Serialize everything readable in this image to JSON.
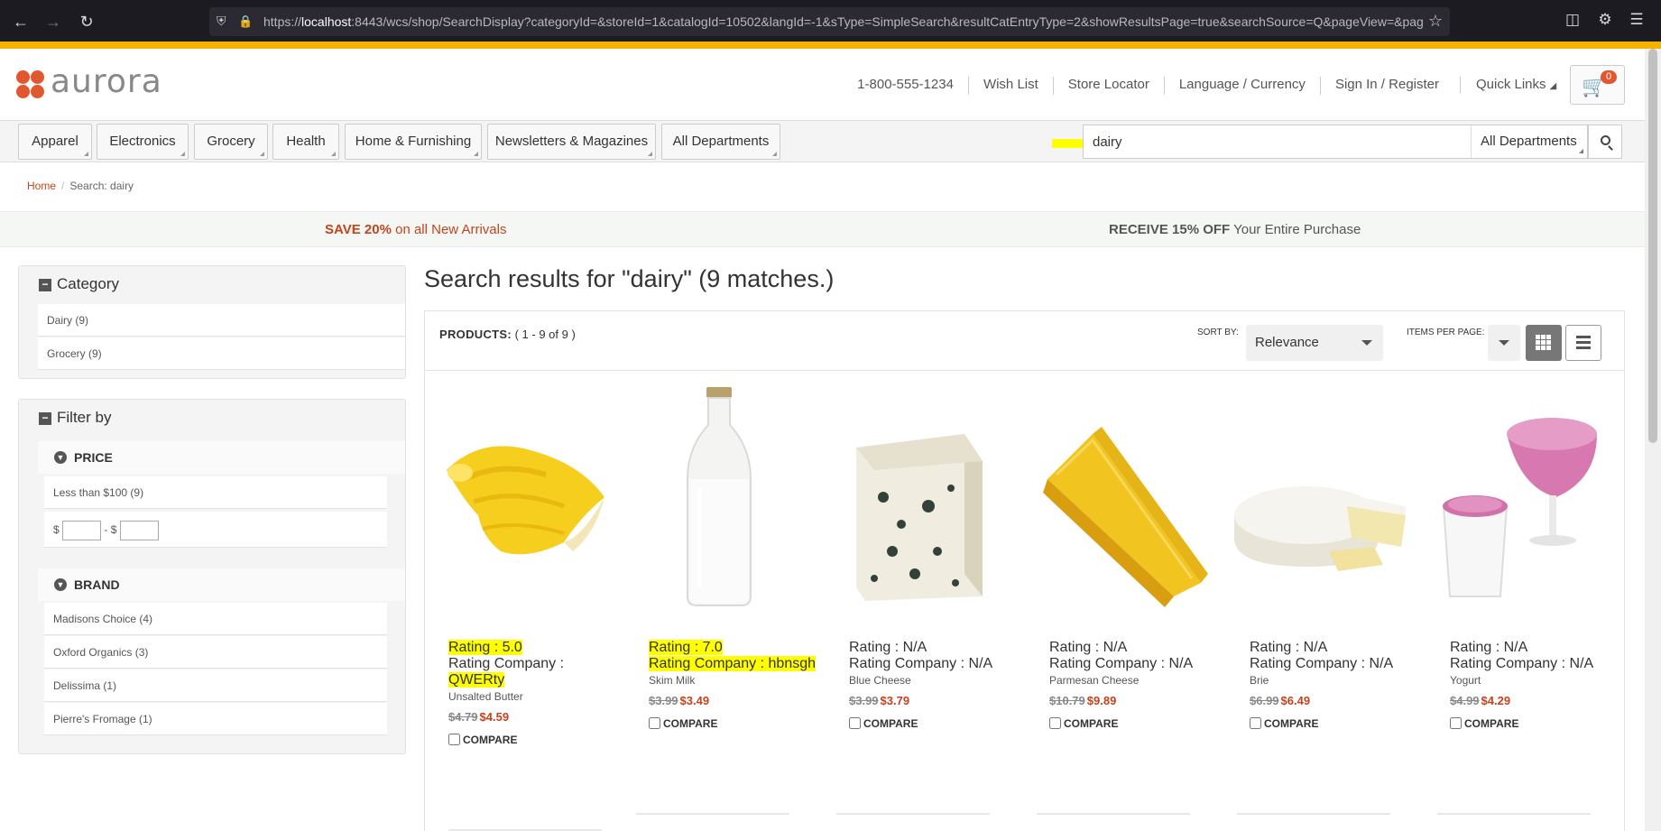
{
  "browser": {
    "url_prefix": "https://",
    "url_host": "localhost",
    "url_rest": ":8443/wcs/shop/SearchDisplay?categoryId=&storeId=1&catalogId=10502&langId=-1&sType=SimpleSearch&resultCatEntryType=2&showResultsPage=true&searchSource=Q&pageView=&pag"
  },
  "header": {
    "logo_text": "aurora",
    "phone": "1-800-555-1234",
    "wish_list": "Wish List",
    "store_locator": "Store Locator",
    "language_currency": "Language / Currency",
    "sign_in": "Sign In / Register",
    "quick_links": "Quick Links",
    "cart_count": "0"
  },
  "nav": {
    "departments": [
      "Apparel",
      "Electronics",
      "Grocery",
      "Health",
      "Home & Furnishing",
      "Newsletters & Magazines",
      "All Departments"
    ],
    "search_value": "dairy",
    "search_dept": "All Departments"
  },
  "breadcrumb": {
    "home": "Home",
    "current": "Search: dairy"
  },
  "promo": {
    "left_bold": "SAVE 20%",
    "left_rest": " on all New Arrivals",
    "right_bold": "RECEIVE 15% OFF",
    "right_rest": " Your Entire Purchase"
  },
  "sidebar": {
    "category_title": "Category",
    "categories": [
      "Dairy (9)",
      "Grocery (9)"
    ],
    "filter_title": "Filter by",
    "price_title": "PRICE",
    "price_options": [
      "Less than $100 (9)"
    ],
    "price_from_label": "$",
    "price_to_label": "- $",
    "brand_title": "BRAND",
    "brands": [
      "Madisons Choice (4)",
      "Oxford Organics (3)",
      "Delissima (1)",
      "Pierre's Fromage (1)"
    ]
  },
  "results": {
    "title": "Search results for \"dairy\" (9 matches.)",
    "products_label": "PRODUCTS:",
    "products_range": "(  1 - 9 of 9  )",
    "sort_label": "SORT BY:",
    "sort_value": "Relevance",
    "ipp_label": "ITEMS PER PAGE:",
    "compare_label": "COMPARE"
  },
  "products": [
    {
      "rating": "Rating : 5.0",
      "company_label": "Rating Company :",
      "company": "QWERty",
      "name": "Unsalted Butter",
      "old_price": "$4.79",
      "new_price": "$4.59"
    },
    {
      "rating": "Rating : 7.0",
      "company_label": "Rating Company :",
      "company": "hbnsgh",
      "name": "Skim Milk",
      "old_price": "$3.99",
      "new_price": "$3.49"
    },
    {
      "rating": "Rating : N/A",
      "company_label": "Rating Company :",
      "company": "N/A",
      "name": "Blue Cheese",
      "old_price": "$3.99",
      "new_price": "$3.79"
    },
    {
      "rating": "Rating : N/A",
      "company_label": "Rating Company :",
      "company": "N/A",
      "name": "Parmesan Cheese",
      "old_price": "$10.79",
      "new_price": "$9.89"
    },
    {
      "rating": "Rating : N/A",
      "company_label": "Rating Company :",
      "company": "N/A",
      "name": "Brie",
      "old_price": "$6.99",
      "new_price": "$6.49"
    },
    {
      "rating": "Rating : N/A",
      "company_label": "Rating Company :",
      "company": "N/A",
      "name": "Yogurt",
      "old_price": "$4.99",
      "new_price": "$4.29"
    }
  ],
  "colors": {
    "accent": "#f3b300",
    "brand": "#e2582e",
    "sale": "#c4431c",
    "highlight": "#ffff00"
  }
}
